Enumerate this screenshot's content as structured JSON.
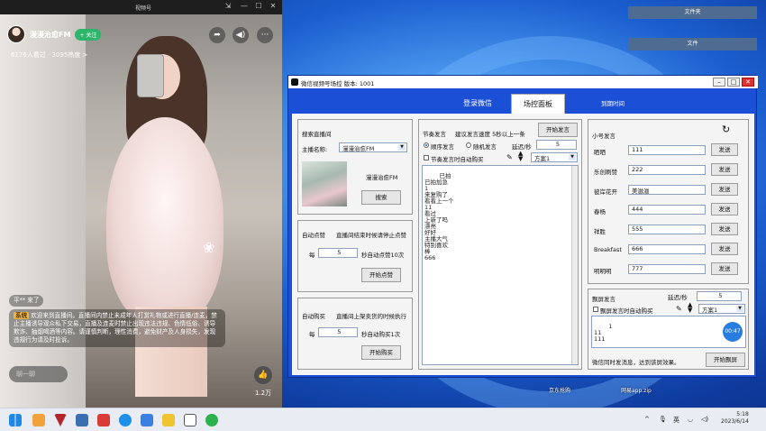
{
  "desktop": {
    "buttons": [
      "文件夹",
      "文件"
    ],
    "icons": [
      "京东抢购",
      "网易app.zip"
    ]
  },
  "phone": {
    "title": "视频号",
    "controls": [
      "⇲",
      "—",
      "☐",
      "✕"
    ],
    "host_name": "漫漫治愈FM",
    "follow_label": "+ 关注",
    "viewers": "6176人看过 · 3095热度 >",
    "chat_join": "平** 来了",
    "chat_notice_level": "系统",
    "chat_notice": "欢迎来到直播间。直播间内禁止未成年人打赏礼物或进行直播/连麦，禁止主播诱导观众私下交易，直播及连麦时禁止出现违法违规、色情低俗、诱导欺诈、抽烟喝酒等内容。请谨慎判断，理性消费，避免财产及人身损失，发现违规行为请及时投诉。",
    "comment_placeholder": "聊一聊",
    "like_count": "1.2万"
  },
  "tool": {
    "title": "微信视频号场控  版本: 1001",
    "tabs": [
      "登录微信",
      "场控面板",
      "到期时间"
    ],
    "search": {
      "title": "搜索直播间",
      "host_label": "主播名称:",
      "host_value": "漫漫治愈FM",
      "host_display": "漫漫治愈FM",
      "search_btn": "搜索"
    },
    "autolike": {
      "title": "自动点赞",
      "hint": "直播间结束时候请停止点赞",
      "every": "每",
      "value": "5",
      "unit": "秒自动点赞10次",
      "start_btn": "开始点赞"
    },
    "autobuy": {
      "title": "自动购买",
      "hint": "直播间上架卖货的时候执行",
      "every": "每",
      "value": "5",
      "unit": "秒自动购买1次",
      "start_btn": "开始购买"
    },
    "rhythm": {
      "title": "节奏发言",
      "speed_hint": "建议发言速度  5秒以上一条",
      "start_btn": "开始发言",
      "seq_label": "顺序发言",
      "rand_label": "随机发言",
      "delay_label": "延迟/秒",
      "delay_value": "5",
      "auto_buy_label": "节奏发言时自动购买",
      "plan_value": "方案1",
      "messages": "已拍\n已拍加急\n1\n来复购了\n看看上一个\n11\n看过\n上新了吗\n漂亮\n好好\n主播大气\n特别喜欢\n棒\n666"
    },
    "accounts": {
      "title": "小号发言",
      "send_label": "发送",
      "rows": [
        {
          "name": "晒晒",
          "msg": "111"
        },
        {
          "name": "乐创刷赞",
          "msg": "222"
        },
        {
          "name": "彼岸花开",
          "msg": "美滋滋"
        },
        {
          "name": "春杨",
          "msg": "444"
        },
        {
          "name": "祥胜",
          "msg": "555"
        },
        {
          "name": "Breakfast",
          "msg": "666"
        },
        {
          "name": "明明明",
          "msg": "777"
        }
      ]
    },
    "danmu": {
      "title": "飘屏发言",
      "delay_label": "延迟/秒",
      "delay_value": "5",
      "auto_buy_label": "飘屏发言时自动购买",
      "plan_value": "方案1",
      "messages": "1\n11\n111",
      "timer": "00:47",
      "hint": "微信同时发消息，达到该屏效果。",
      "start_btn": "开始飘屏"
    }
  },
  "taskbar": {
    "tray_lang": "英",
    "tray_arrow": "^",
    "time": "5:18",
    "date": "2023/6/14"
  }
}
